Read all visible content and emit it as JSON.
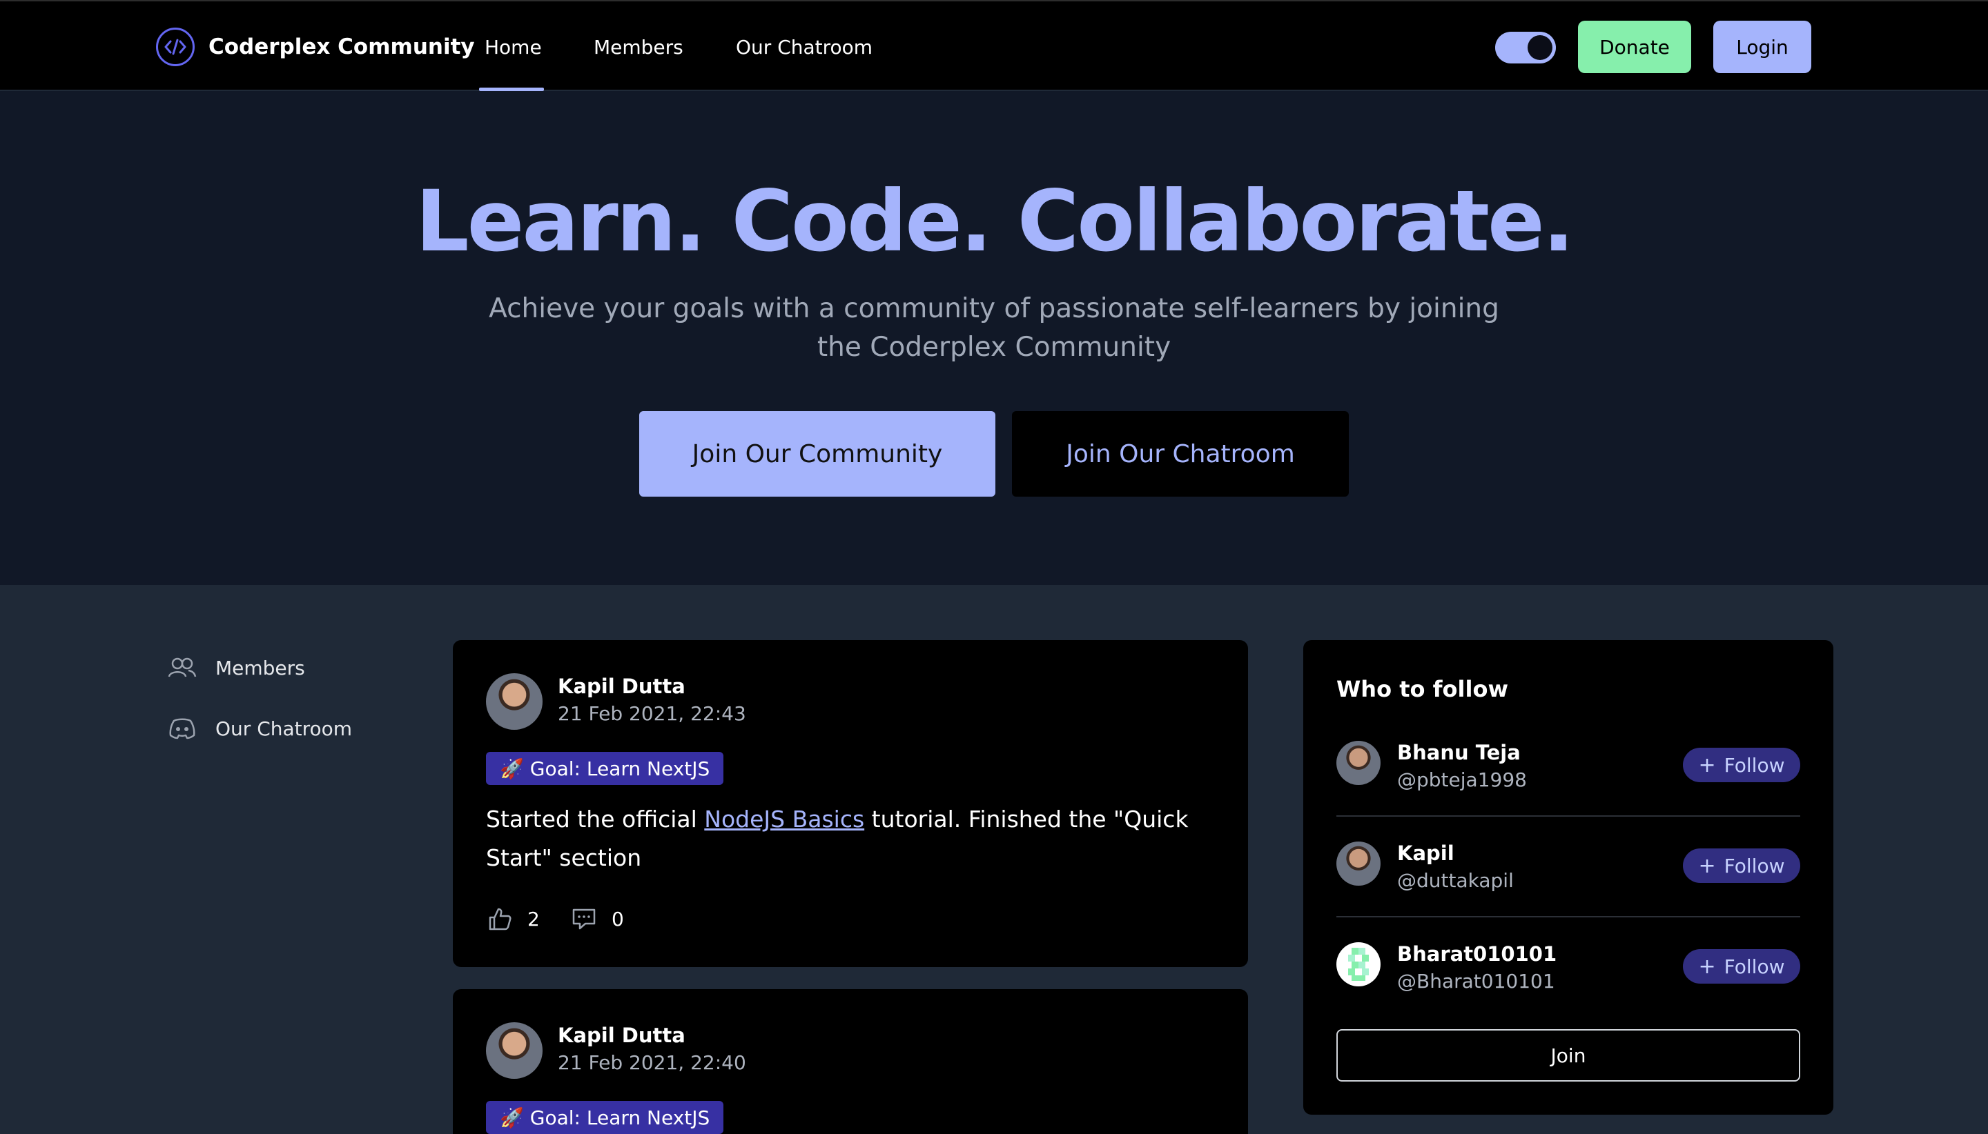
{
  "navbar": {
    "brand_name": "Coderplex Community",
    "links": [
      "Home",
      "Members",
      "Our Chatroom"
    ],
    "active_link": "Home",
    "donate_label": "Donate",
    "login_label": "Login"
  },
  "hero": {
    "title": "Learn. Code. Collaborate.",
    "subtitle": "Achieve your goals with a community of passionate self-learners by joining the Coderplex Community",
    "primary_cta": "Join Our Community",
    "secondary_cta": "Join Our Chatroom"
  },
  "sidebar": {
    "items": [
      {
        "label": "Members",
        "icon": "users-icon"
      },
      {
        "label": "Our Chatroom",
        "icon": "discord-icon"
      }
    ]
  },
  "posts": [
    {
      "author": "Kapil Dutta",
      "date": "21 Feb 2021, 22:43",
      "goal": "🚀 Goal: Learn NextJS",
      "text_before": "Started the official ",
      "link_text": "NodeJS Basics",
      "text_after": " tutorial. Finished the \"Quick Start\" section",
      "likes": "2",
      "comments": "0"
    },
    {
      "author": "Kapil Dutta",
      "date": "21 Feb 2021, 22:40",
      "goal": "🚀 Goal: Learn NextJS"
    }
  ],
  "who_to_follow": {
    "title": "Who to follow",
    "follow_label": "Follow",
    "users": [
      {
        "name": "Bhanu Teja",
        "handle": "@pbteja1998"
      },
      {
        "name": "Kapil",
        "handle": "@duttakapil"
      },
      {
        "name": "Bharat010101",
        "handle": "@Bharat010101"
      }
    ],
    "join_label": "Join"
  },
  "colors": {
    "accent": "#a5b4fc",
    "donate": "#86efac",
    "hero_bg": "#111827",
    "page_bg": "#1f2937",
    "badge": "#3730a3"
  }
}
